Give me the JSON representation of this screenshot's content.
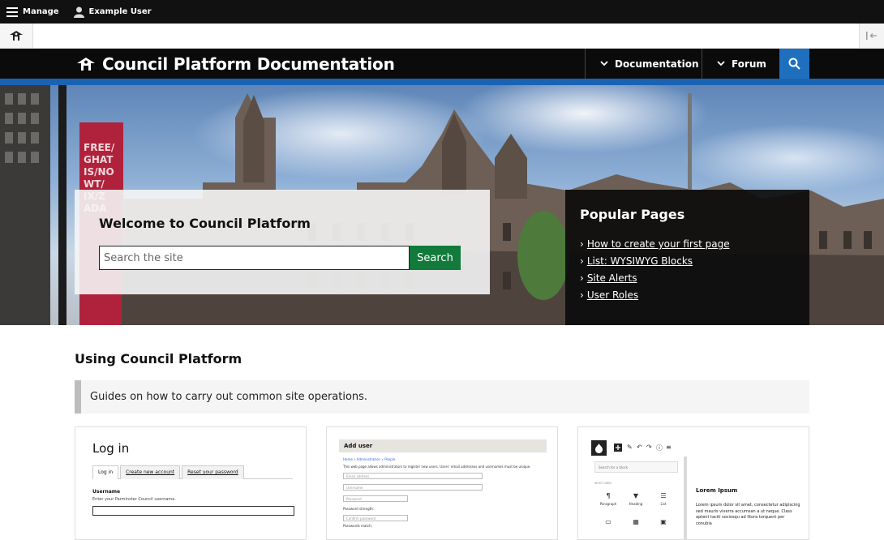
{
  "toolbar": {
    "manage_label": "Manage",
    "user_label": "Example User"
  },
  "site": {
    "title": "Council Platform Documentation",
    "nav": [
      {
        "label": "Documentation"
      },
      {
        "label": "Forum"
      }
    ],
    "hero_banner_text": "FREE/ GHAT IS/NO WT/ IX/Z ADA"
  },
  "welcome": {
    "heading": "Welcome to Council Platform",
    "search_placeholder": "Search the site",
    "search_button": "Search"
  },
  "popular": {
    "heading": "Popular Pages",
    "links": [
      "How to create your first page",
      "List: WYSIWYG Blocks",
      "Site Alerts",
      "User Roles"
    ]
  },
  "content": {
    "section_title": "Using Council Platform",
    "callout": "Guides on how to carry out common site operations."
  },
  "cards": {
    "login": {
      "title": "Log in",
      "tabs": [
        "Log in",
        "Create new account",
        "Reset your password"
      ],
      "username_label": "Username",
      "username_hint": "Enter your Parminster Council username."
    },
    "adduser": {
      "title": "Add user",
      "breadcrumb": "Home » Administration » People",
      "description": "This web page allows administrators to register new users. Users' email addresses and usernames must be unique.",
      "email_ph": "Email address",
      "username_ph": "Username",
      "password_ph": "Password",
      "strength": "Password strength:",
      "confirm_ph": "Confirm password",
      "match": "Passwords match:"
    },
    "editor": {
      "search_ph": "Search for a block",
      "most_used": "MOST USED",
      "blocks": [
        "Paragraph",
        "Heading",
        "List"
      ],
      "lorem_title": "Lorem Ipsum",
      "lorem_text": "Lorem ipsum dolor sit amet, consectetur adipiscing sed mauris viverra accumsan a ut neque. Class aptent taciti sociosqu ad litora torquent per conubia"
    }
  }
}
